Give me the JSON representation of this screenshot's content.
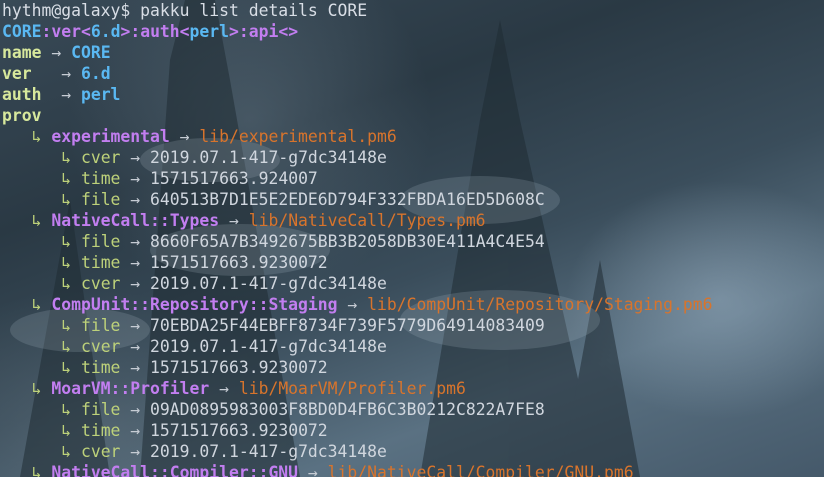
{
  "prompt": {
    "user": "hythm",
    "at": "@",
    "host": "galaxy",
    "sym": "$",
    "command": "pakku list details CORE"
  },
  "header": {
    "name": "CORE",
    "ver_key": ":ver",
    "ver_open": "<",
    "ver_val": "6.d",
    "ver_close": ">",
    "auth_key": ":auth",
    "auth_open": "<",
    "auth_val": "perl",
    "auth_close": ">",
    "api_key": ":api",
    "api_empty": "<>"
  },
  "arrow": "→",
  "sub_marker": "↳",
  "fields": [
    {
      "key": "name",
      "pad": "",
      "value": "CORE"
    },
    {
      "key": "ver",
      "pad": "  ",
      "value": "6.d"
    },
    {
      "key": "auth",
      "pad": " ",
      "value": "perl"
    }
  ],
  "prov_label": "prov",
  "provides": [
    {
      "module": "experimental",
      "path": "lib/experimental.pm6",
      "attrs": [
        {
          "key": "cver",
          "value": "2019.07.1-417-g7dc34148e"
        },
        {
          "key": "time",
          "value": "1571517663.924007"
        },
        {
          "key": "file",
          "value": "640513B7D1E5E2EDE6D794F332FBDA16ED5D608C"
        }
      ]
    },
    {
      "module": "NativeCall::Types",
      "path": "lib/NativeCall/Types.pm6",
      "attrs": [
        {
          "key": "file",
          "value": "8660F65A7B3492675BB3B2058DB30E411A4C4E54"
        },
        {
          "key": "time",
          "value": "1571517663.9230072"
        },
        {
          "key": "cver",
          "value": "2019.07.1-417-g7dc34148e"
        }
      ]
    },
    {
      "module": "CompUnit::Repository::Staging",
      "path": "lib/CompUnit/Repository/Staging.pm6",
      "attrs": [
        {
          "key": "file",
          "value": "70EBDA25F44EBFF8734F739F5779D64914083409"
        },
        {
          "key": "cver",
          "value": "2019.07.1-417-g7dc34148e"
        },
        {
          "key": "time",
          "value": "1571517663.9230072"
        }
      ]
    },
    {
      "module": "MoarVM::Profiler",
      "path": "lib/MoarVM/Profiler.pm6",
      "attrs": [
        {
          "key": "file",
          "value": "09AD0895983003F8BD0D4FB6C3B0212C822A7FE8"
        },
        {
          "key": "time",
          "value": "1571517663.9230072"
        },
        {
          "key": "cver",
          "value": "2019.07.1-417-g7dc34148e"
        }
      ]
    },
    {
      "module": "NativeCall::Compiler::GNU",
      "path": "lib/NativeCall/Compiler/GNU.pm6",
      "attrs": []
    }
  ],
  "colors": {
    "key": "#d7e89c",
    "value_blue": "#5ab8f2",
    "module": "#c27ef0",
    "path": "#d8742c",
    "subkey": "#bdd17a",
    "plain": "#d0d6de"
  }
}
